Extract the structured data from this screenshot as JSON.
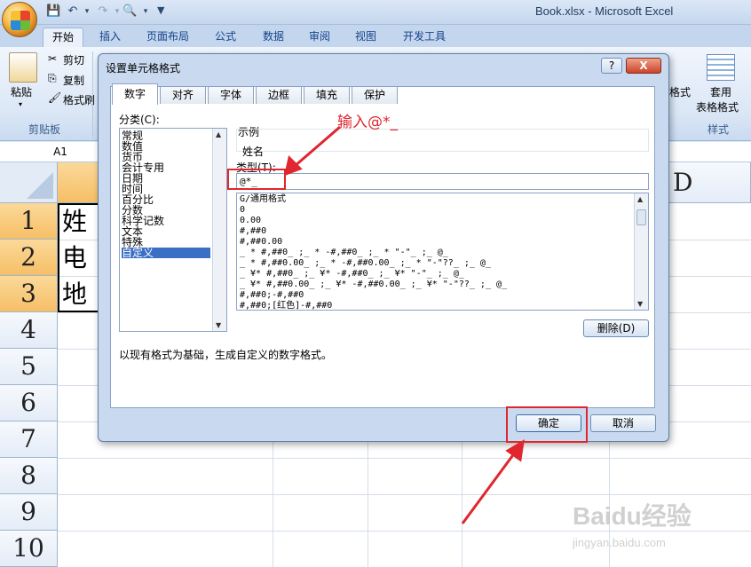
{
  "window": {
    "title": "Book.xlsx - Microsoft Excel"
  },
  "ribbon": {
    "tabs": [
      "开始",
      "插入",
      "页面布局",
      "公式",
      "数据",
      "审阅",
      "视图",
      "开发工具"
    ],
    "active_tab": "开始",
    "clipboard": {
      "paste": "粘贴",
      "cut": "剪切",
      "copy": "复制",
      "format_painter": "格式刷",
      "group": "剪贴板"
    },
    "styles": {
      "cell_styles_partial": "格式",
      "table_format_line1": "套用",
      "table_format_line2": "表格格式",
      "group": "样式"
    }
  },
  "formula_bar": {
    "name_box": "A1"
  },
  "sheet": {
    "column_headers": [
      "D"
    ],
    "row_headers": [
      "1",
      "2",
      "3",
      "4",
      "5",
      "6",
      "7",
      "8",
      "9",
      "10"
    ],
    "cells": [
      "姓",
      "电",
      "地"
    ]
  },
  "dialog": {
    "title": "设置单元格格式",
    "help_label": "?",
    "close_label": "X",
    "tabs": [
      "数字",
      "对齐",
      "字体",
      "边框",
      "填充",
      "保护"
    ],
    "active_tab": "数字",
    "category_label": "分类(C):",
    "categories": [
      "常规",
      "数值",
      "货币",
      "会计专用",
      "日期",
      "时间",
      "百分比",
      "分数",
      "科学记数",
      "文本",
      "特殊",
      "自定义"
    ],
    "selected_category": "自定义",
    "sample_label": "示例",
    "sample_value": "姓名",
    "type_label": "类型(T):",
    "type_value": "@*_",
    "formats": [
      "G/通用格式",
      "0",
      "0.00",
      "#,##0",
      "#,##0.00",
      "_ * #,##0_ ;_ * -#,##0_ ;_ * \"-\"_ ;_ @_",
      "_ * #,##0.00_ ;_ * -#,##0.00_ ;_ * \"-\"??_ ;_ @_",
      "_ ¥* #,##0_ ;_ ¥* -#,##0_ ;_ ¥* \"-\"_ ;_ @_",
      "_ ¥* #,##0.00_ ;_ ¥* -#,##0.00_ ;_ ¥* \"-\"??_ ;_ @_",
      "#,##0;-#,##0",
      "#,##0;[红色]-#,##0"
    ],
    "delete_button": "删除(D)",
    "description": "以现有格式为基础，生成自定义的数字格式。",
    "ok_button": "确定",
    "cancel_button": "取消"
  },
  "annotation": {
    "text": "输入@*_",
    "color": "#e0262e"
  },
  "watermark": {
    "brand": "Baidu经验",
    "url": "jingyan.baidu.com"
  }
}
